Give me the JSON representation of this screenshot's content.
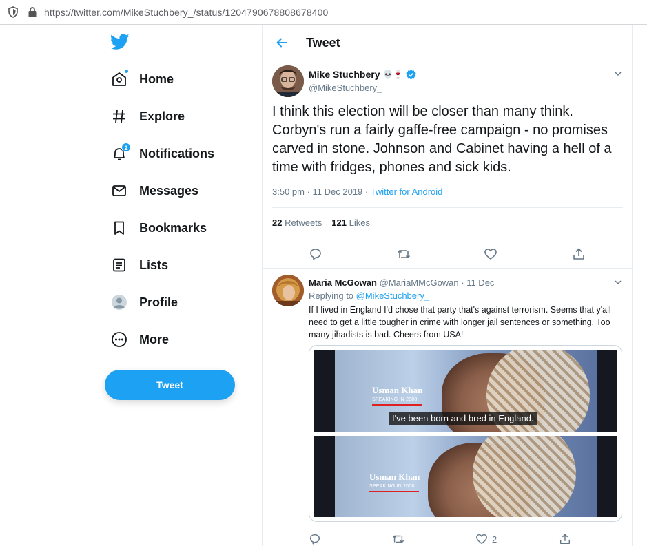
{
  "browser": {
    "url": "https://twitter.com/MikeStuchbery_/status/1204790678808678400"
  },
  "nav": {
    "items": [
      {
        "label": "Home"
      },
      {
        "label": "Explore"
      },
      {
        "label": "Notifications",
        "badge": "2"
      },
      {
        "label": "Messages"
      },
      {
        "label": "Bookmarks"
      },
      {
        "label": "Lists"
      },
      {
        "label": "Profile"
      },
      {
        "label": "More"
      }
    ],
    "tweet_button": "Tweet"
  },
  "header": {
    "title": "Tweet"
  },
  "tweet": {
    "author_name": "Mike Stuchbery",
    "author_emoji": "💀🍷",
    "handle": "@MikeStuchbery_",
    "text": "I think this election will be closer than many think. Corbyn's run a fairly gaffe-free campaign - no promises carved in stone. Johnson and Cabinet having a hell of a time with fridges, phones and sick kids.",
    "time": "3:50 pm · 11 Dec 2019 · ",
    "source": "Twitter for Android",
    "retweets": "22",
    "retweets_label": "Retweets",
    "likes": "121",
    "likes_label": "Likes"
  },
  "reply": {
    "author_name": "Maria McGowan",
    "handle_date": "@MariaMMcGowan · 11 Dec",
    "replying_prefix": "Replying to ",
    "replying_to": "@MikeStuchbery_",
    "text": "If I lived in England I'd chose that party that's against terrorism.  Seems that y'all need to get a little tougher in crime with longer jail sentences or something.  Too many jihadists is bad. Cheers from USA!",
    "likes": "2",
    "media": {
      "caption_name": "Usman Khan",
      "caption_sub": "SPEAKING IN 2008",
      "subtitle": "I've been born and bred in England."
    }
  },
  "colors": {
    "accent": "#1da1f2",
    "text": "#14171a",
    "muted": "#657786",
    "border": "#e6ecf0"
  }
}
